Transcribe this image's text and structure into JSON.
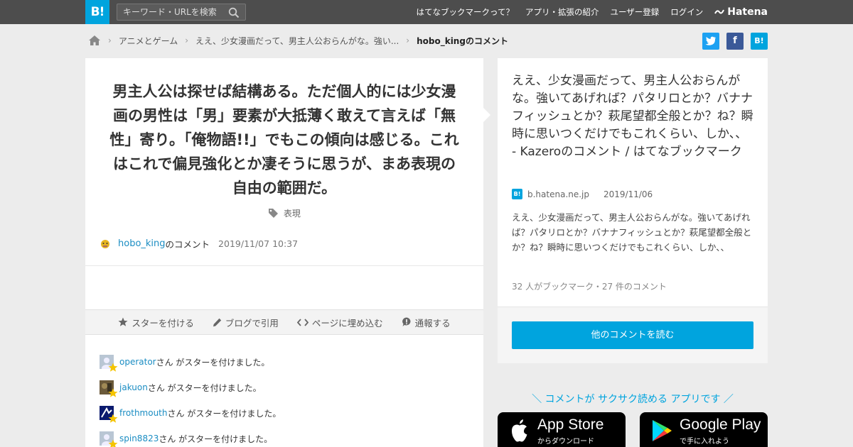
{
  "header": {
    "logo": "B!",
    "search_placeholder": "キーワード・URLを検索",
    "nav": [
      "はてなブックマークって？",
      "アプリ・拡張の紹介",
      "ユーザー登録",
      "ログイン"
    ],
    "brand": "Hatena"
  },
  "breadcrumb": {
    "items": [
      "アニメとゲーム",
      "ええ、少女漫画だって、男主人公おらんがな。強い...",
      "hobo_kingのコメント"
    ]
  },
  "share": {
    "twitter": "t",
    "facebook": "f",
    "hatena": "B!"
  },
  "comment": {
    "text": "男主人公は探せば結構ある。ただ個人的には少女漫画の男性は「男」要素が大抵薄く敢えて言えば「無性」寄り。「俺物語!!」でもこの傾向は感じる。これはこれで偏見強化とか凄そうに思うが、まあ表現の自由の範囲だ。",
    "tag": "表現",
    "author": "hobo_king",
    "author_suffix": "のコメント",
    "date": "2019/11/07 10:37"
  },
  "actions": [
    "スターを付ける",
    "ブログで引用",
    "ページに埋め込む",
    "通報する"
  ],
  "stars": {
    "suffix": "さん がスターを付けました。",
    "users": [
      "operator",
      "jakuon",
      "frothmouth",
      "spin8823"
    ]
  },
  "entry": {
    "title": "ええ、少女漫画だって、男主人公おらんがな。強いてあげれば？パタリロとか？バナナフィッシュとか？萩尾望都全般とか？ね？瞬時に思いつくだけでもこれくらい、しか、、 - Kazeroのコメント / はてなブックマーク",
    "favicon": "B!",
    "domain": "b.hatena.ne.jp",
    "date": "2019/11/06",
    "summary": "ええ、少女漫画だって、男主人公おらんがな。強いてあげれば？パタリロとか？バナナフィッシュとか？萩尾望都全般とか？ね？瞬時に思いつくだけでもこれくらい、しか、、",
    "counts": "32 人がブックマーク・27 件のコメント",
    "read_more": "他のコメントを読む"
  },
  "app_promo": {
    "tagline": "＼ コメントが サクサク読める アプリです ／",
    "appstore_name": "App Store",
    "appstore_sub": "からダウンロード",
    "google_name": "Google Play",
    "google_sub": "で手に入れよう"
  },
  "colors": {
    "accent": "#00a4de",
    "header_bg": "#4d4d4d",
    "link": "#1b8dc3",
    "star": "#f5c400",
    "twitter": "#1da1f2",
    "facebook": "#3b5998"
  }
}
